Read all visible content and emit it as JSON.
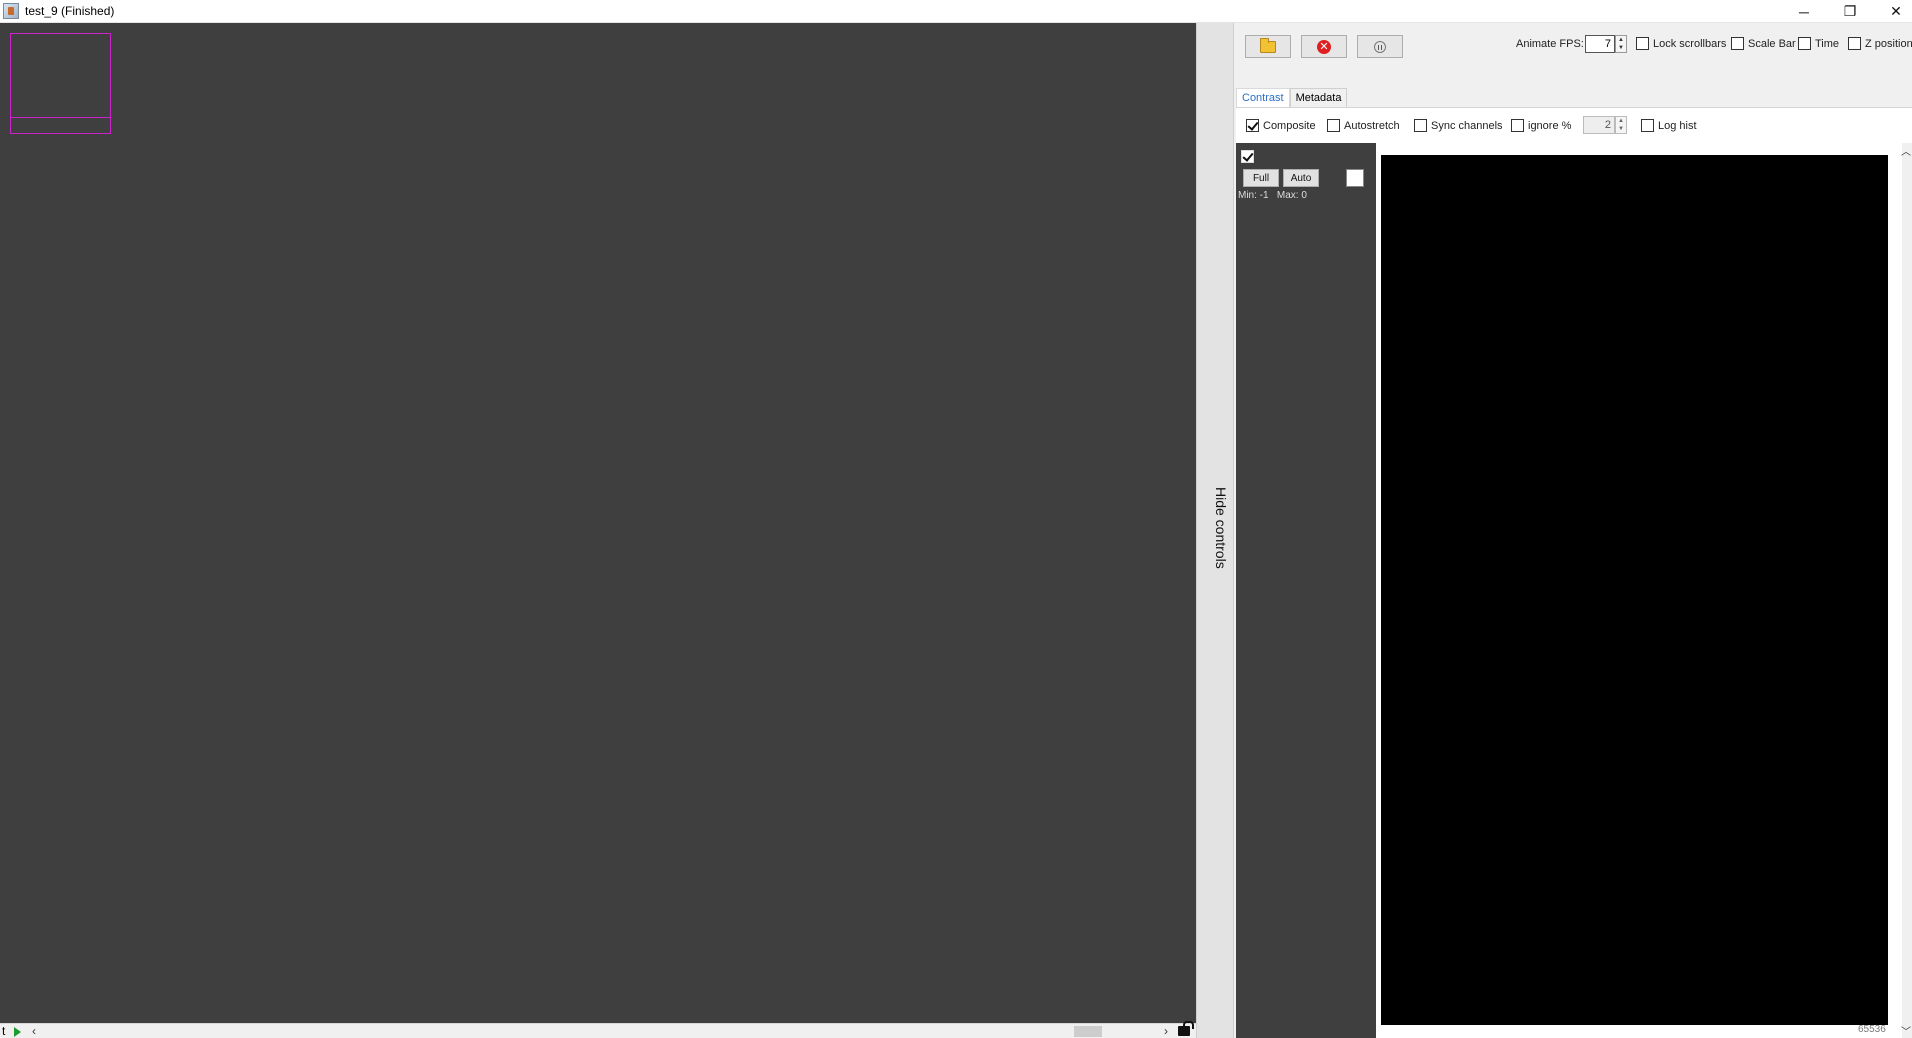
{
  "window": {
    "title": "test_9 (Finished)",
    "minimize_glyph": "─",
    "maximize_glyph": "❐",
    "close_glyph": "✕"
  },
  "viewer": {
    "background": "#3f3f3f",
    "roi_color": "#cc22cc",
    "time_label": "t",
    "scroll_left": "‹",
    "scroll_right": "›"
  },
  "hide_controls_label": "Hide controls",
  "toolbar": {
    "animate_fps_label": "Animate FPS:",
    "animate_fps_value": "7",
    "options": [
      {
        "label": "Lock scrollbars",
        "checked": false
      },
      {
        "label": "Scale Bar",
        "checked": false
      },
      {
        "label": "Time",
        "checked": false
      },
      {
        "label": "Z position",
        "checked": false
      }
    ]
  },
  "tabs": [
    {
      "label": "Contrast",
      "active": true
    },
    {
      "label": "Metadata",
      "active": false
    }
  ],
  "contrast": {
    "options": [
      {
        "label": "Composite",
        "checked": true
      },
      {
        "label": "Autostretch",
        "checked": false
      },
      {
        "label": "Sync channels",
        "checked": false
      },
      {
        "label": "ignore %",
        "checked": false
      }
    ],
    "ignore_value": "2",
    "log_hist_label": "Log hist",
    "channel": {
      "enabled": true,
      "full_label": "Full",
      "auto_label": "Auto",
      "min_label": "Min: -1",
      "max_label": "Max: 0",
      "color": "#ffffff"
    },
    "histogram_max": "65536"
  }
}
